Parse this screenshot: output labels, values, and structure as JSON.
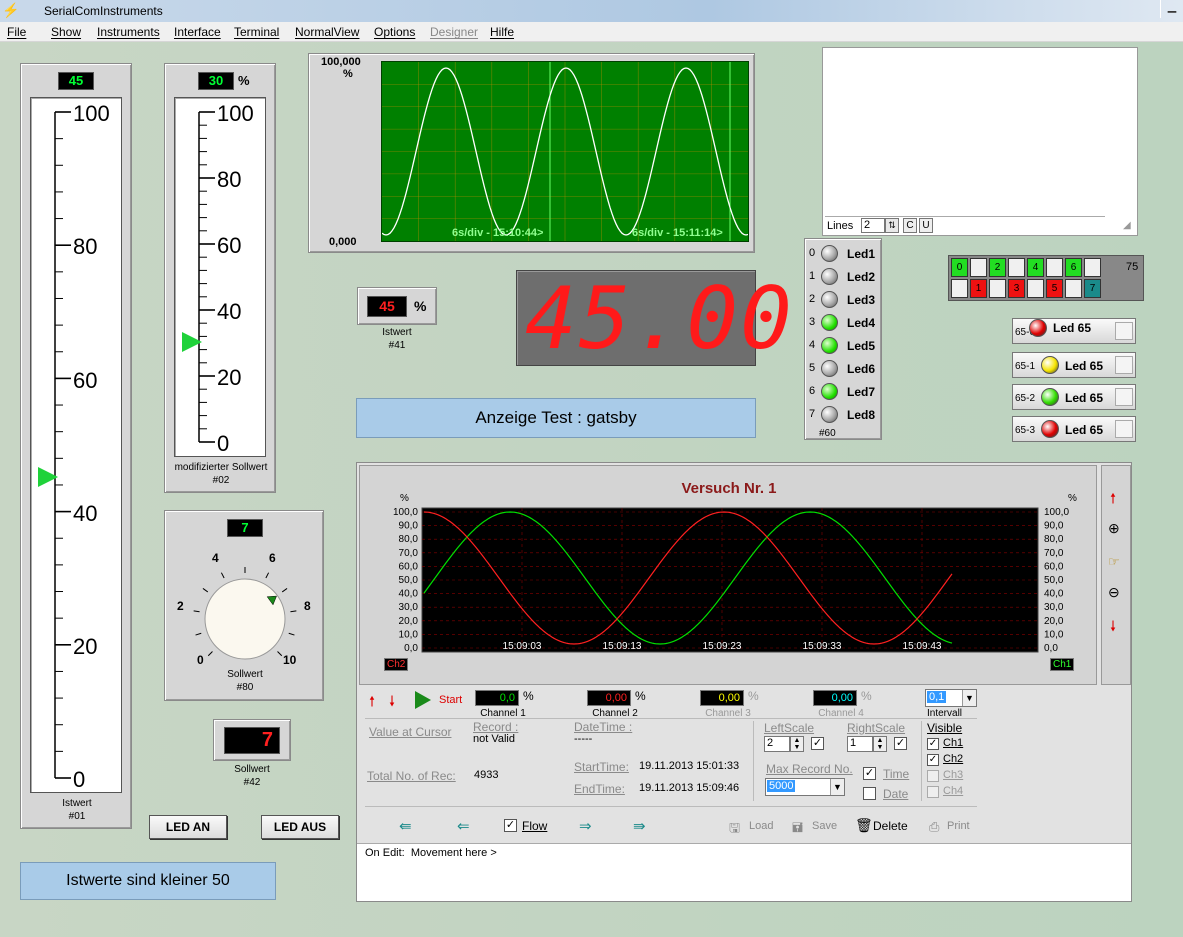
{
  "window": {
    "title": "SerialComInstruments"
  },
  "menu": {
    "items": [
      "File",
      "Show",
      "Instruments",
      "Interface",
      "Terminal",
      "NormalView",
      "Options",
      "Designer",
      "Hilfe"
    ],
    "disabled": [
      "Designer"
    ]
  },
  "istwert01": {
    "value": "45",
    "ticks": [
      "100",
      "80",
      "60",
      "40",
      "20",
      "0"
    ],
    "label": "Istwert",
    "id": "#01",
    "level": 0.45
  },
  "sollwert02": {
    "value": "30",
    "unit": "%",
    "ticks": [
      "100",
      "80",
      "60",
      "40",
      "20",
      "0"
    ],
    "label": "modifizierter Sollwert",
    "id": "#02",
    "level": 0.3
  },
  "scope": {
    "ymax": "100,000",
    "yunit": "%",
    "ymin": "0,000",
    "label1": "6s/div - 15:10:44>",
    "label2": "6s/div - 15:11:14>",
    "bg": "#008000"
  },
  "istwert41": {
    "value": "45",
    "unit": "%",
    "label": "Istwert",
    "id": "#41"
  },
  "bigdisplay": {
    "value": "45.00",
    "color": "#ff1a1a"
  },
  "info_test": {
    "text": "Anzeige Test : gatsby"
  },
  "knob80": {
    "value": "7",
    "ticks": [
      "0",
      "2",
      "4",
      "6",
      "8",
      "10"
    ],
    "label": "Sollwert",
    "id": "#80",
    "level": 0.7
  },
  "sollwert42": {
    "value": "7",
    "label": "Sollwert",
    "id": "#42"
  },
  "buttons": {
    "led_an": "LED AN",
    "led_aus": "LED AUS"
  },
  "info_istwert": {
    "text": "Istwerte sind kleiner 50"
  },
  "terminal": {
    "lines_label": "Lines",
    "lines_value": "2",
    "c": "C",
    "u": "U"
  },
  "leds60": {
    "items": [
      {
        "n": "0",
        "label": "Led1",
        "on": false
      },
      {
        "n": "1",
        "label": "Led2",
        "on": false
      },
      {
        "n": "2",
        "label": "Led3",
        "on": false
      },
      {
        "n": "3",
        "label": "Led4",
        "on": true
      },
      {
        "n": "4",
        "label": "Led5",
        "on": true
      },
      {
        "n": "5",
        "label": "Led6",
        "on": false
      },
      {
        "n": "6",
        "label": "Led7",
        "on": true
      },
      {
        "n": "7",
        "label": "Led8",
        "on": false
      }
    ],
    "id": "#60"
  },
  "bitpanel": {
    "top": [
      "0",
      "",
      "2",
      "",
      "4",
      "",
      "6",
      ""
    ],
    "bottom": [
      "",
      "1",
      "",
      "3",
      "",
      "5",
      "",
      "7"
    ],
    "value": "75"
  },
  "led65": [
    {
      "prefix": "65-0",
      "label": "Led 65",
      "color": "#e00000"
    },
    {
      "prefix": "65-1",
      "label": "Led 65",
      "color": "#f5e400"
    },
    {
      "prefix": "65-2",
      "label": "Led 65",
      "color": "#33dd00"
    },
    {
      "prefix": "65-3",
      "label": "Led 65",
      "color": "#e00000"
    }
  ],
  "recorder": {
    "title": "Versuch Nr. 1",
    "yunit": "%",
    "yticks": [
      "100,0",
      "90,0",
      "80,0",
      "70,0",
      "60,0",
      "50,0",
      "40,0",
      "30,0",
      "20,0",
      "10,0",
      "0,0"
    ],
    "xticks": [
      "15:09:03",
      "15:09:13",
      "15:09:23",
      "15:09:33",
      "15:09:43"
    ],
    "left_tag": "Ch2",
    "right_tag": "Ch1",
    "start": "Start",
    "channels": [
      {
        "value": "0,0",
        "unit": "%",
        "label": "Channel 1",
        "color": "#00e000"
      },
      {
        "value": "0,00",
        "unit": "%",
        "label": "Channel 2",
        "color": "#ff2020"
      },
      {
        "value": "0,00",
        "unit": "%",
        "label": "Channel 3",
        "color": "#ffff00"
      },
      {
        "value": "0,00",
        "unit": "%",
        "label": "Channel 4",
        "color": "#00ffff"
      }
    ],
    "intervall_value": "0,1",
    "intervall_label": "Intervall",
    "value_at_cursor": "Value at Cursor",
    "record_label": "Record :",
    "record_value": "not Valid",
    "datetime_label": "DateTime :",
    "datetime_value": "-----",
    "total_label": "Total No. of Rec:",
    "total_value": "4933",
    "start_time_label": "StartTime:",
    "start_time": "19.11.2013 15:01:33",
    "end_time_label": "EndTime:",
    "end_time": "19.11.2013 15:09:46",
    "leftscale_label": "LeftScale",
    "leftscale_value": "2",
    "rightscale_label": "RightScale",
    "rightscale_value": "1",
    "maxrec_label": "Max Record No.",
    "maxrec_value": "5000",
    "time_label": "Time",
    "date_label": "Date",
    "visible_label": "Visible",
    "visible": [
      "Ch1",
      "Ch2",
      "Ch3",
      "Ch4"
    ],
    "flow": "Flow",
    "load": "Load",
    "save": "Save",
    "delete": "Delete",
    "print": "Print",
    "status": "On Edit:  Movement here >"
  },
  "chart_data": {
    "type": "line",
    "title": "Versuch Nr. 1",
    "x": [
      "15:09:03",
      "15:09:13",
      "15:09:23",
      "15:09:33",
      "15:09:43"
    ],
    "ylim": [
      0,
      100
    ],
    "series": [
      {
        "name": "Ch1",
        "color": "#00e000"
      },
      {
        "name": "Ch2",
        "color": "#ff2020"
      }
    ]
  }
}
